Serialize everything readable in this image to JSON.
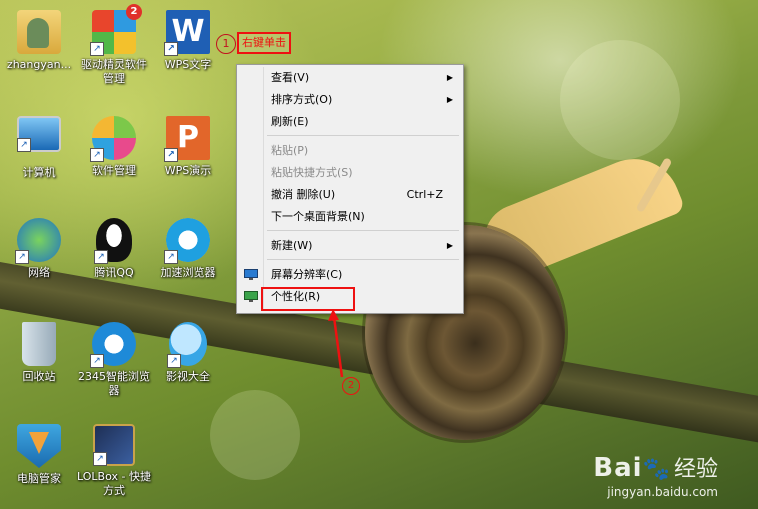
{
  "desktop_icons": [
    {
      "label": "zhangyan...",
      "icon": "user-folder-icon"
    },
    {
      "label": "驱动精灵软件管理",
      "icon": "driver-genius-icon",
      "badge": "2"
    },
    {
      "label": "WPS文字",
      "icon": "wps-writer-icon"
    },
    {
      "label": "计算机",
      "icon": "computer-icon"
    },
    {
      "label": "软件管理",
      "icon": "software-manager-icon"
    },
    {
      "label": "WPS演示",
      "icon": "wps-presentation-icon"
    },
    {
      "label": "网络",
      "icon": "network-icon"
    },
    {
      "label": "腾讯QQ",
      "icon": "qq-icon"
    },
    {
      "label": "加速浏览器",
      "icon": "accelerated-browser-icon"
    },
    {
      "label": "回收站",
      "icon": "recycle-bin-icon"
    },
    {
      "label": "2345智能浏览器",
      "icon": "browser-2345-icon"
    },
    {
      "label": "影视大全",
      "icon": "video-app-icon"
    },
    {
      "label": "电脑管家",
      "icon": "pc-manager-icon"
    },
    {
      "label": "LOLBox - 快捷方式",
      "icon": "lolbox-icon"
    }
  ],
  "context_menu": {
    "items": [
      {
        "label": "查看(V)",
        "submenu": true
      },
      {
        "label": "排序方式(O)",
        "submenu": true
      },
      {
        "label": "刷新(E)"
      },
      {
        "label": "粘贴(P)",
        "disabled": true
      },
      {
        "label": "粘贴快捷方式(S)",
        "disabled": true
      },
      {
        "label": "撤消 删除(U)",
        "shortcut": "Ctrl+Z"
      },
      {
        "label": "下一个桌面背景(N)"
      },
      {
        "label": "新建(W)",
        "submenu": true
      },
      {
        "label": "屏幕分辨率(C)",
        "icon": "display-icon"
      },
      {
        "label": "个性化(R)",
        "icon": "personalize-icon"
      }
    ]
  },
  "annotations": {
    "step1_number": "1",
    "step1_text": "右键单击",
    "step2_number": "2"
  },
  "watermark": {
    "brand": "Bai",
    "brand_suffix": "经验",
    "url": "jingyan.baidu.com"
  },
  "colors": {
    "annotation_red": "#e11111",
    "menu_background": "#f0f0f0"
  }
}
